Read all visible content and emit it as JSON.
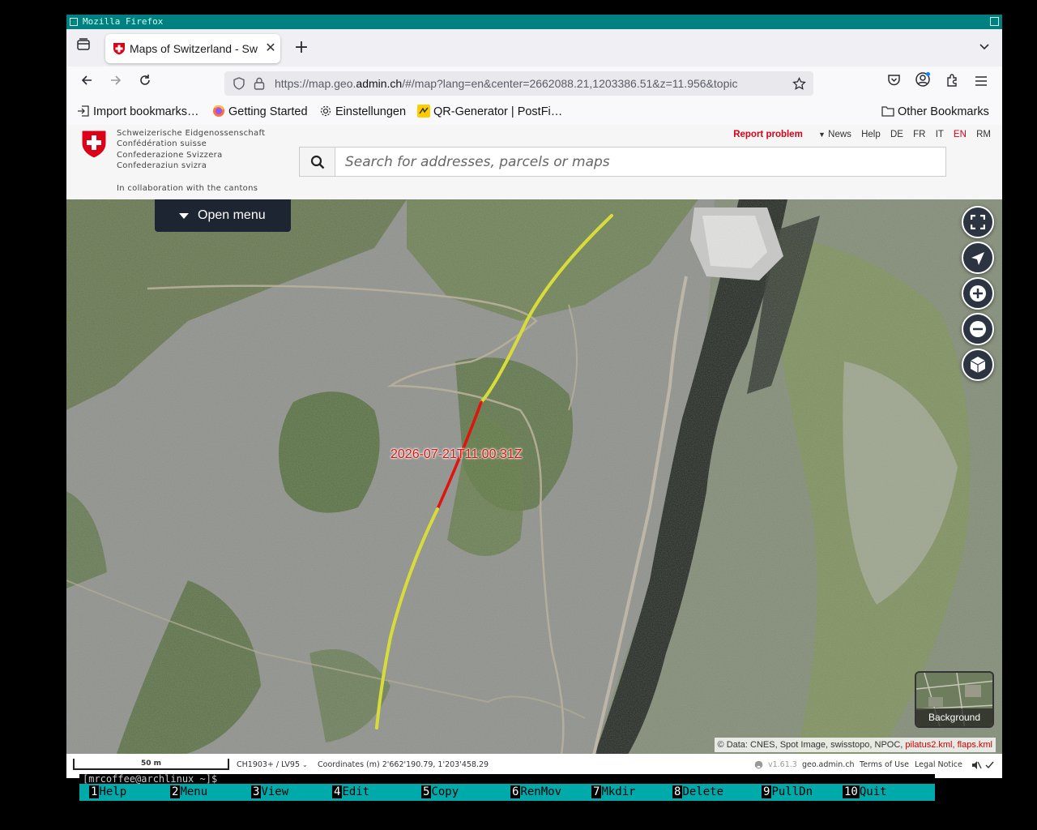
{
  "window": {
    "title": "Mozilla Firefox"
  },
  "tab": {
    "title": "Maps of Switzerland - Swi",
    "close_icon": "close-icon"
  },
  "url": {
    "prefix": "https://map.geo.",
    "domain": "admin.ch",
    "rest": "/#/map?lang=en&center=2662088.21,1203386.51&z=11.956&topic"
  },
  "bookmarks": {
    "items": [
      {
        "label": "Import bookmarks…",
        "icon": "import-icon"
      },
      {
        "label": "Getting Started",
        "icon": "firefox-icon"
      },
      {
        "label": "Einstellungen",
        "icon": "gear-icon"
      },
      {
        "label": "QR-Generator | PostFi…",
        "icon": "postfinance-icon"
      }
    ],
    "other": "Other Bookmarks"
  },
  "header": {
    "confed_lines": [
      "Schweizerische Eidgenossenschaft",
      "Confédération suisse",
      "Confederazione Svizzera",
      "Confederaziun svizra"
    ],
    "collab": "In collaboration with the cantons",
    "report_problem": "Report problem",
    "news": "News",
    "help": "Help",
    "langs": [
      "DE",
      "FR",
      "IT",
      "EN",
      "RM"
    ],
    "active_lang": "EN",
    "search_placeholder": "Search for addresses, parcels or maps"
  },
  "map": {
    "open_menu": "Open menu",
    "track_label": "2026-07-21T11:00:31Z",
    "background_label": "Background",
    "attribution": {
      "prefix": "© Data: ",
      "sources": "CNES, Spot Image, swisstopo, NPOC, ",
      "kml": "pilatus2.kml, flaps.kml"
    }
  },
  "footer": {
    "scale": "50 m",
    "projection": "CH1903+ / LV95",
    "coordinates": "Coordinates (m) 2'662'190.79, 1'203'458.29",
    "version": "v1.61.3",
    "site": "geo.admin.ch",
    "terms": "Terms of Use",
    "legal": "Legal Notice"
  },
  "terminal": {
    "prompt": "[mrcoffee@archlinux ~]$ ",
    "fkeys": [
      {
        "n": "1",
        "label": "Help"
      },
      {
        "n": "2",
        "label": "Menu"
      },
      {
        "n": "3",
        "label": "View"
      },
      {
        "n": "4",
        "label": "Edit"
      },
      {
        "n": "5",
        "label": "Copy"
      },
      {
        "n": "6",
        "label": "RenMov"
      },
      {
        "n": "7",
        "label": "Mkdir"
      },
      {
        "n": "8",
        "label": "Delete"
      },
      {
        "n": "9",
        "label": "PullDn"
      },
      {
        "n": "10",
        "label": "Quit"
      }
    ]
  },
  "colors": {
    "accent_red": "#dc0018",
    "menu_bg": "#1d2532",
    "track_yellow": "#d8dc3a",
    "track_red": "#e0140c",
    "mc_cyan": "#00aaaa"
  }
}
